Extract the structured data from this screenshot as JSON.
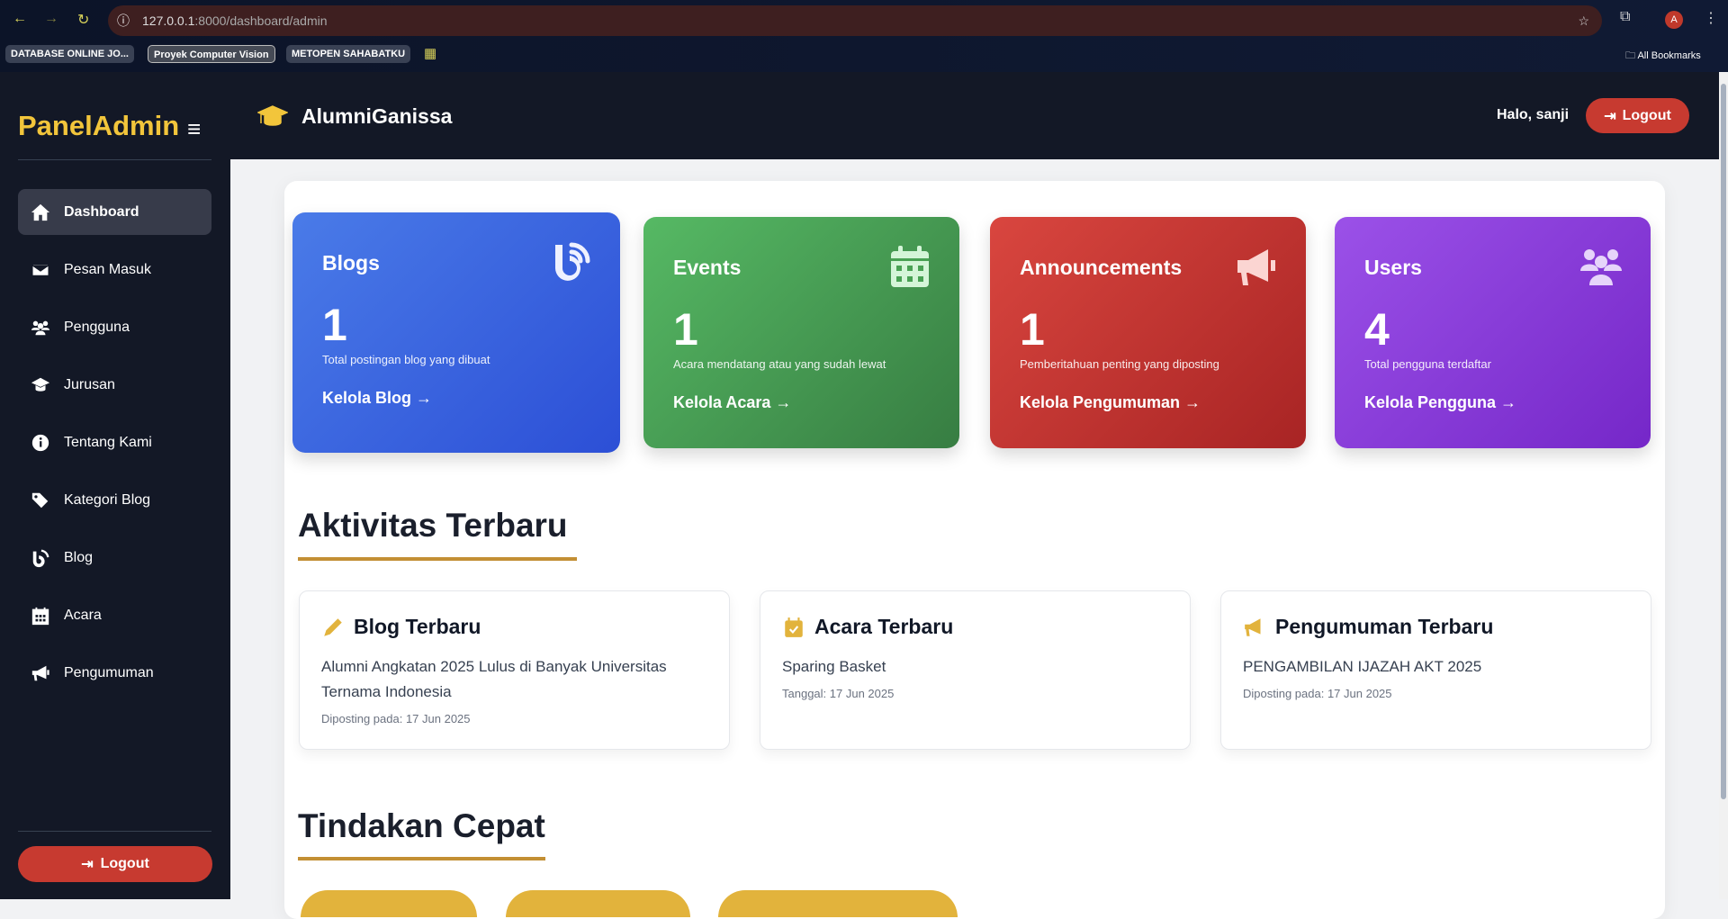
{
  "browser": {
    "url_host": "127.0.0.1",
    "url_path": ":8000/dashboard/admin",
    "bookmarks": [
      "DATABASE ONLINE JO...",
      "Proyek Computer Vision",
      "METOPEN SAHABATKU"
    ],
    "all_bookmarks": "All Bookmarks",
    "profile_initial": "A"
  },
  "sidebar": {
    "brand": "PanelAdmin",
    "items": [
      {
        "label": "Dashboard",
        "icon": "home-icon"
      },
      {
        "label": "Pesan Masuk",
        "icon": "envelope-icon"
      },
      {
        "label": "Pengguna",
        "icon": "users-icon"
      },
      {
        "label": "Jurusan",
        "icon": "graduation-cap-icon"
      },
      {
        "label": "Tentang Kami",
        "icon": "info-icon"
      },
      {
        "label": "Kategori Blog",
        "icon": "tags-icon"
      },
      {
        "label": "Blog",
        "icon": "blog-icon"
      },
      {
        "label": "Acara",
        "icon": "calendar-icon"
      },
      {
        "label": "Pengumuman",
        "icon": "bullhorn-icon"
      }
    ],
    "logout": "Logout"
  },
  "header": {
    "title": "AlumniGanissa",
    "greeting": "Halo, sanji",
    "logout": "Logout"
  },
  "stats": [
    {
      "title": "Blogs",
      "count": "1",
      "desc": "Total postingan blog yang dibuat",
      "link": "Kelola Blog",
      "color_from": "#4a7be8",
      "color_to": "#2c4fd6"
    },
    {
      "title": "Events",
      "count": "1",
      "desc": "Acara mendatang atau yang sudah lewat",
      "link": "Kelola Acara",
      "color_from": "#56b964",
      "color_to": "#377d42"
    },
    {
      "title": "Announcements",
      "count": "1",
      "desc": "Pemberitahuan penting yang diposting",
      "link": "Kelola Pengumuman",
      "color_from": "#d9463f",
      "color_to": "#a82424"
    },
    {
      "title": "Users",
      "count": "4",
      "desc": "Total pengguna terdaftar",
      "link": "Kelola Pengguna",
      "color_from": "#9b51e8",
      "color_to": "#7527c8"
    }
  ],
  "activity": {
    "heading": "Aktivitas Terbaru",
    "cards": [
      {
        "title": "Blog Terbaru",
        "body": "Alumni Angkatan 2025 Lulus di Banyak Universitas Ternama Indonesia",
        "meta": "Diposting pada: 17 Jun 2025"
      },
      {
        "title": "Acara Terbaru",
        "body": "Sparing Basket",
        "meta": "Tanggal: 17 Jun 2025"
      },
      {
        "title": "Pengumuman Terbaru",
        "body": "PENGAMBILAN IJAZAH AKT 2025",
        "meta": "Diposting pada: 17 Jun 2025"
      }
    ]
  },
  "quick": {
    "heading": "Tindakan Cepat"
  },
  "colors": {
    "accent": "#f2c53b",
    "danger": "#c73a30",
    "sidebar": "#131826",
    "underline": "#c38f34"
  }
}
